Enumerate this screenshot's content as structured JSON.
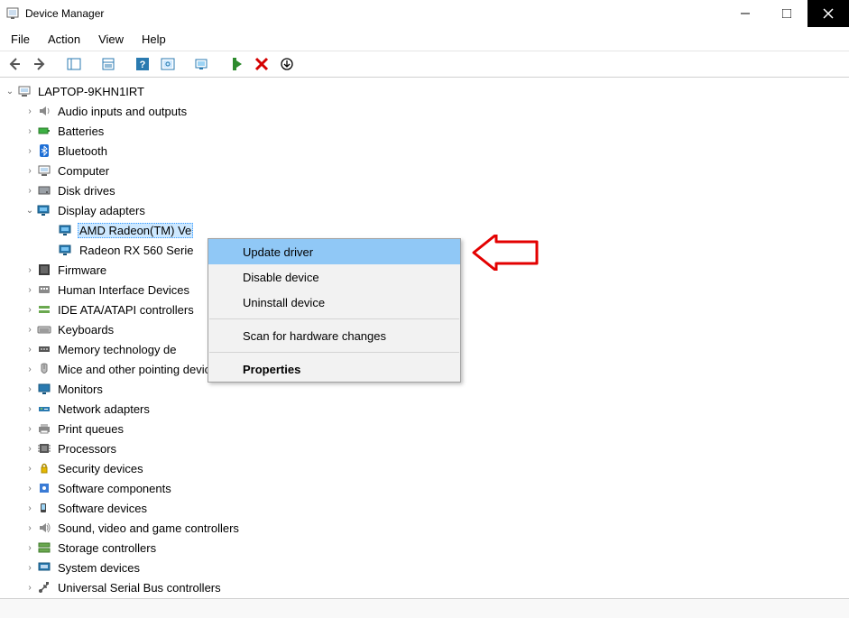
{
  "window": {
    "title": "Device Manager"
  },
  "menubar": [
    "File",
    "Action",
    "View",
    "Help"
  ],
  "tree": [
    {
      "level": 0,
      "caret": "open",
      "icon": "computer",
      "text": "LAPTOP-9KHN1IRT"
    },
    {
      "level": 1,
      "caret": "closed",
      "icon": "audio",
      "text": "Audio inputs and outputs"
    },
    {
      "level": 1,
      "caret": "closed",
      "icon": "battery",
      "text": "Batteries"
    },
    {
      "level": 1,
      "caret": "closed",
      "icon": "bluetooth",
      "text": "Bluetooth"
    },
    {
      "level": 1,
      "caret": "closed",
      "icon": "computer",
      "text": "Computer"
    },
    {
      "level": 1,
      "caret": "closed",
      "icon": "disk",
      "text": "Disk drives"
    },
    {
      "level": 1,
      "caret": "open",
      "icon": "display",
      "text": "Display adapters"
    },
    {
      "level": 2,
      "caret": "",
      "icon": "display",
      "text": "AMD Radeon(TM) Ve",
      "selected": true
    },
    {
      "level": 2,
      "caret": "",
      "icon": "display",
      "text": "Radeon RX 560 Serie"
    },
    {
      "level": 1,
      "caret": "closed",
      "icon": "firmware",
      "text": "Firmware"
    },
    {
      "level": 1,
      "caret": "closed",
      "icon": "hid",
      "text": "Human Interface Devices"
    },
    {
      "level": 1,
      "caret": "closed",
      "icon": "ide",
      "text": "IDE ATA/ATAPI controllers"
    },
    {
      "level": 1,
      "caret": "closed",
      "icon": "keyboard",
      "text": "Keyboards"
    },
    {
      "level": 1,
      "caret": "closed",
      "icon": "memory",
      "text": "Memory technology de"
    },
    {
      "level": 1,
      "caret": "closed",
      "icon": "mouse",
      "text": "Mice and other pointing devices"
    },
    {
      "level": 1,
      "caret": "closed",
      "icon": "monitor",
      "text": "Monitors"
    },
    {
      "level": 1,
      "caret": "closed",
      "icon": "network",
      "text": "Network adapters"
    },
    {
      "level": 1,
      "caret": "closed",
      "icon": "printer",
      "text": "Print queues"
    },
    {
      "level": 1,
      "caret": "closed",
      "icon": "processor",
      "text": "Processors"
    },
    {
      "level": 1,
      "caret": "closed",
      "icon": "security",
      "text": "Security devices"
    },
    {
      "level": 1,
      "caret": "closed",
      "icon": "component",
      "text": "Software components"
    },
    {
      "level": 1,
      "caret": "closed",
      "icon": "softdev",
      "text": "Software devices"
    },
    {
      "level": 1,
      "caret": "closed",
      "icon": "sound",
      "text": "Sound, video and game controllers"
    },
    {
      "level": 1,
      "caret": "closed",
      "icon": "storage",
      "text": "Storage controllers"
    },
    {
      "level": 1,
      "caret": "closed",
      "icon": "system",
      "text": "System devices"
    },
    {
      "level": 1,
      "caret": "closed",
      "icon": "usb",
      "text": "Universal Serial Bus controllers"
    }
  ],
  "context_menu": [
    "Update driver",
    "Disable device",
    "Uninstall device",
    "Scan for hardware changes",
    "Properties"
  ],
  "statusbar": ""
}
